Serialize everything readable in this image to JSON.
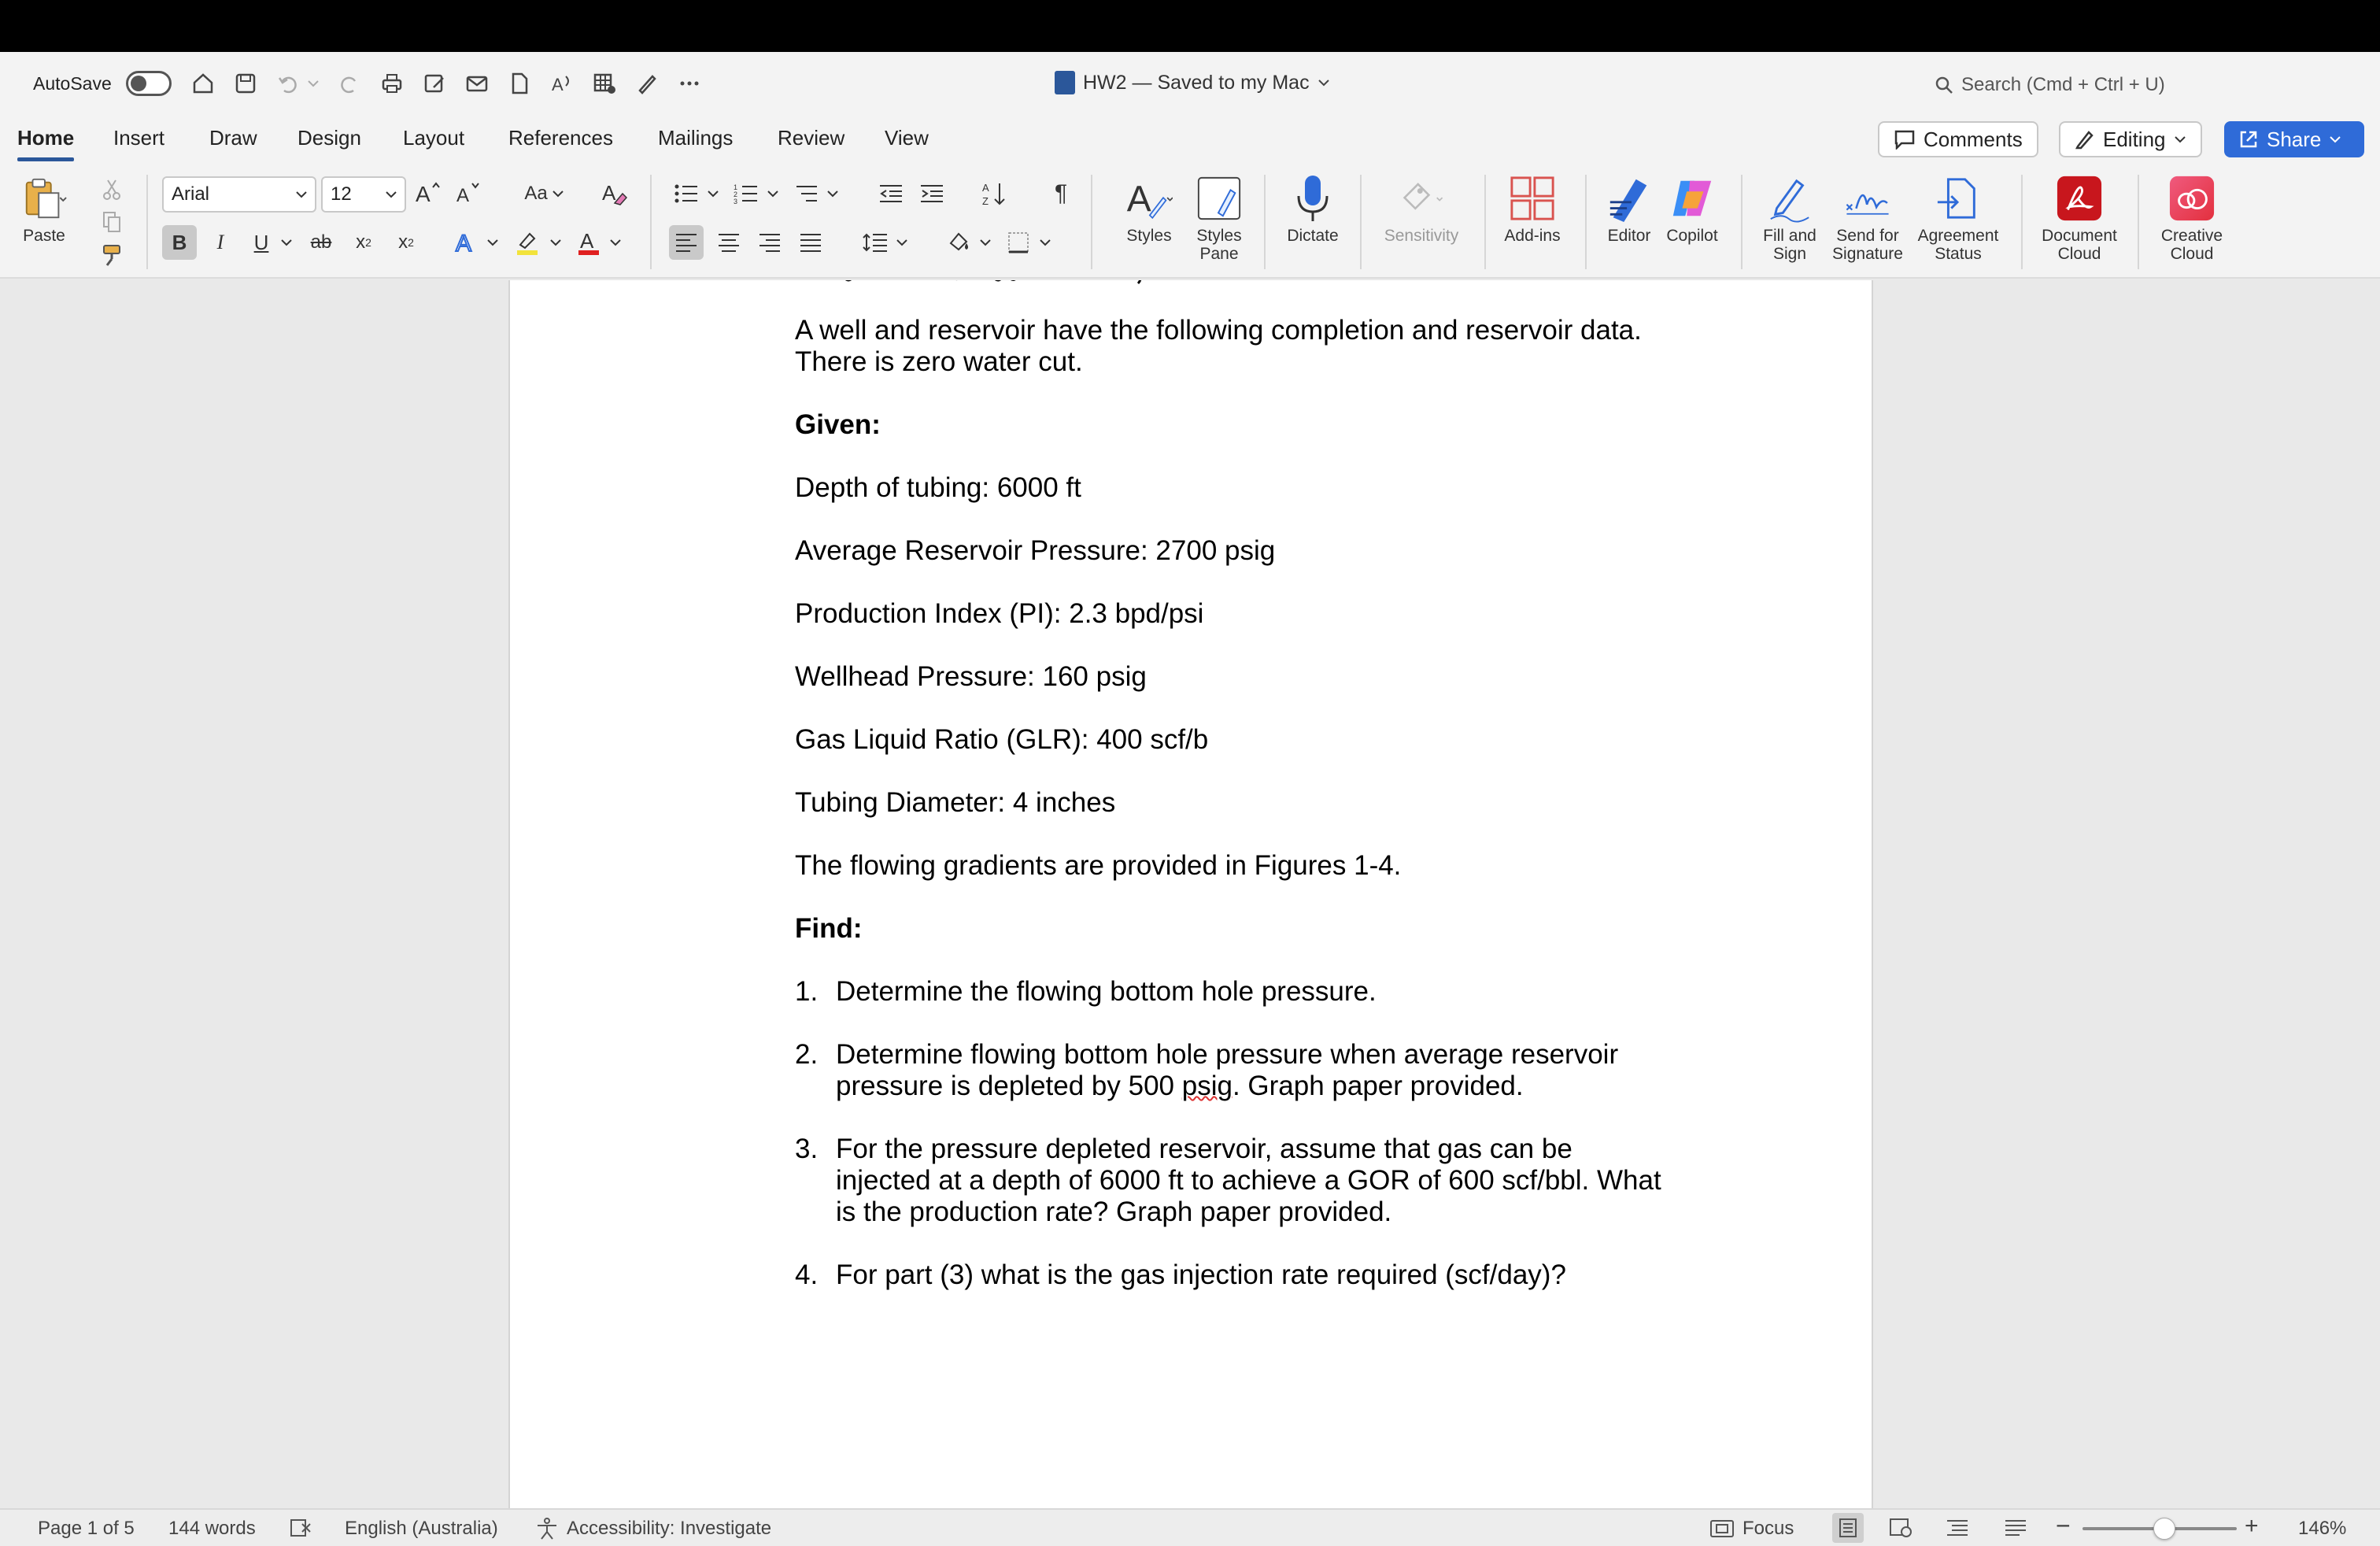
{
  "titlebar": {
    "autosave_label": "AutoSave",
    "doc_title": "HW2 — Saved to my Mac",
    "search_placeholder": "Search (Cmd + Ctrl + U)"
  },
  "tabs": [
    "Home",
    "Insert",
    "Draw",
    "Design",
    "Layout",
    "References",
    "Mailings",
    "Review",
    "View"
  ],
  "actions": {
    "comments": "Comments",
    "editing": "Editing",
    "share": "Share"
  },
  "ribbon": {
    "paste": "Paste",
    "font_name": "Arial",
    "font_size": "12",
    "case_label": "Aa",
    "styles": "Styles",
    "styles_pane": [
      "Styles",
      "Pane"
    ],
    "dictate": "Dictate",
    "sensitivity": "Sensitivity",
    "addins": "Add-ins",
    "editor": "Editor",
    "copilot": "Copilot",
    "fill_sign": [
      "Fill and",
      "Sign"
    ],
    "send_sig": [
      "Send for",
      "Signature"
    ],
    "agreement": [
      "Agreement",
      "Status"
    ],
    "doc_cloud": [
      "Document",
      "Cloud"
    ],
    "creative_cloud": [
      "Creative",
      "Cloud"
    ]
  },
  "document": {
    "intro_1": "A well and reservoir have the following completion and reservoir data.",
    "intro_2": "There is zero water cut.",
    "given": "Given:",
    "depth": "Depth of tubing: 6000 ft",
    "avg_pressure": "Average Reservoir Pressure: 2700 psig",
    "pi": "Production Index (PI): 2.3 bpd/psi",
    "wellhead": "Wellhead Pressure: 160 psig",
    "glr": "Gas Liquid Ratio (GLR): 400 scf/b",
    "tubing": "Tubing Diameter: 4 inches",
    "gradients": "The flowing gradients are provided in Figures 1-4.",
    "find": "Find:",
    "items": [
      {
        "num": "1.",
        "lines": [
          "Determine the flowing bottom hole pressure."
        ]
      },
      {
        "num": "2.",
        "lines": [
          "Determine flowing bottom hole pressure when average reservoir",
          "pressure is depleted by 500 ",
          "psig",
          ". Graph paper provided."
        ]
      },
      {
        "num": "3.",
        "lines": [
          "For the pressure depleted reservoir, assume that gas can be",
          "injected at a depth of 6000 ft to achieve a GOR of 600 scf/bbl. What",
          "is the production rate? Graph paper provided."
        ]
      },
      {
        "num": "4.",
        "lines": [
          "For part (3) what is the gas injection rate required (scf/day)?"
        ]
      }
    ]
  },
  "status": {
    "page": "Page 1 of 5",
    "words": "144 words",
    "language": "English (Australia)",
    "accessibility": "Accessibility: Investigate",
    "focus": "Focus",
    "zoom": "146%"
  }
}
